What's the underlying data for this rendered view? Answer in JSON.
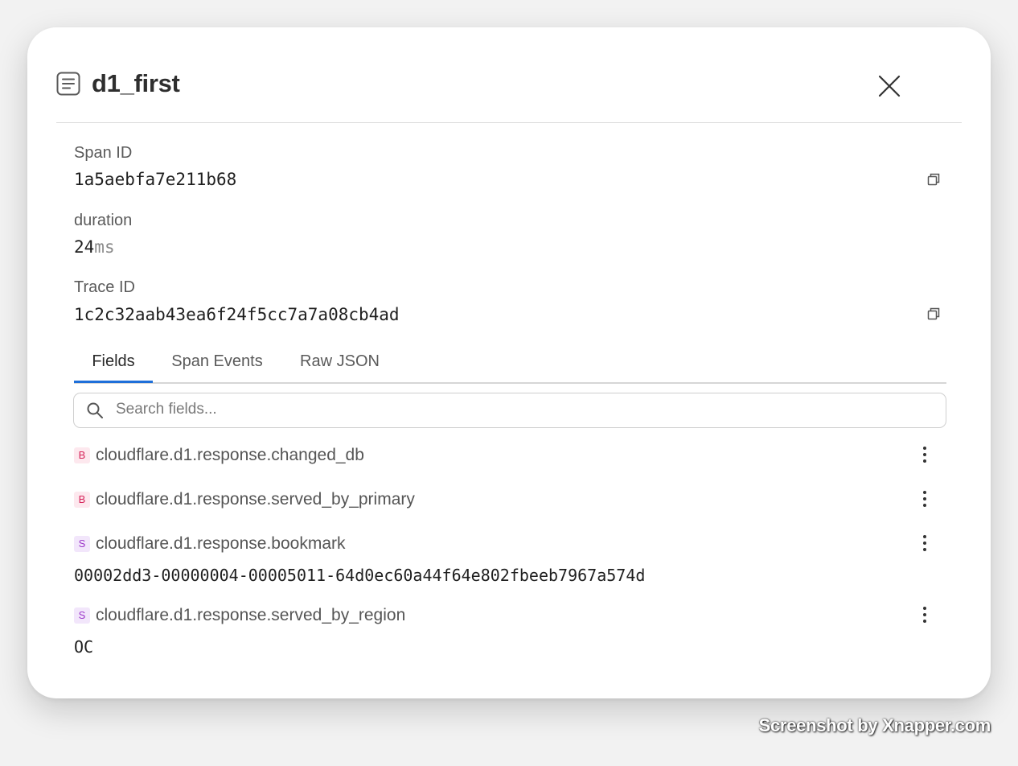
{
  "panel": {
    "title": "d1_first",
    "title_icon": "document-lines-icon",
    "close_icon": "close-icon"
  },
  "meta": {
    "span_id_label": "Span ID",
    "span_id_value": "1a5aebfa7e211b68",
    "duration_label": "duration",
    "duration_value": "24",
    "duration_unit": "ms",
    "trace_id_label": "Trace ID",
    "trace_id_value": "1c2c32aab43ea6f24f5cc7a7a08cb4ad",
    "copy_icon": "copy-icon"
  },
  "tabs": [
    {
      "label": "Fields",
      "active": true
    },
    {
      "label": "Span Events",
      "active": false
    },
    {
      "label": "Raw JSON",
      "active": false
    }
  ],
  "search": {
    "placeholder": "Search fields...",
    "value": ""
  },
  "fields": [
    {
      "type": "B",
      "name": "cloudflare.d1.response.changed_db",
      "value": ""
    },
    {
      "type": "B",
      "name": "cloudflare.d1.response.served_by_primary",
      "value": ""
    },
    {
      "type": "S",
      "name": "cloudflare.d1.response.bookmark",
      "value": "00002dd3-00000004-00005011-64d0ec60a44f64e802fbeeb7967a574d"
    },
    {
      "type": "S",
      "name": "cloudflare.d1.response.served_by_region",
      "value": "OC"
    }
  ],
  "colors": {
    "accent": "#1e6fd9",
    "badge_boolean": "#d6245a",
    "badge_string": "#9b35c9"
  },
  "watermark": "Screenshot by Xnapper.com"
}
